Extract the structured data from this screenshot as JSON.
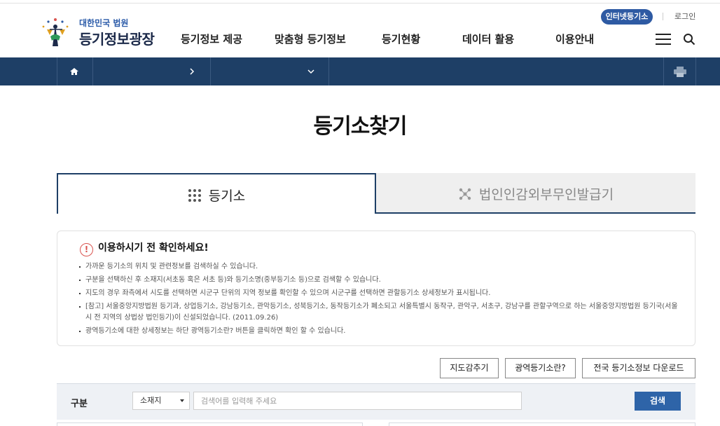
{
  "header": {
    "logo_sub": "대한민국 법원",
    "logo_main": "등기정보광장",
    "util_internet": "인터넷등기소",
    "util_login": "로그인",
    "gnb": [
      "등기정보 제공",
      "맞춤형 등기정보",
      "등기현황",
      "데이터 활용",
      "이용안내"
    ]
  },
  "page": {
    "title": "등기소찾기"
  },
  "tabs": [
    {
      "label": "등기소",
      "icon": "grid-dots-icon",
      "active": true
    },
    {
      "label": "법인인감외부무인발급기",
      "icon": "network-icon",
      "active": false
    }
  ],
  "notice": {
    "title": "이용하시기 전 확인하세요!",
    "items": [
      "가까운 등기소의 위치 및 관련정보를 검색하실 수 있습니다.",
      "구분을 선택하신 후 소재지(서초동 혹은 서초 등)와 등기소명(중부등기소 등)으로 검색할 수 있습니다.",
      "지도의 경우 좌측에서 시도를 선택하면 시군구 단위의 지역 정보를 확인할 수 있으며 시군구를 선택하면 관할등기소 상세정보가 표시됩니다.",
      "[참고] 서울중앙지방법원 등기과, 상업등기소, 강남등기소, 관악등기소, 성북등기소, 동작등기소가 폐소되고 서울특별시 동작구, 관악구, 서초구, 강남구를 관할구역으로 하는 서울중앙지방법원 등기국(서울시 전 지역의 상법상 법인등기)이 신설되었습니다. (2011.09.26)",
      "광역등기소에 대한 상세정보는 하단 광역등기소란? 버튼을 클릭하면 확인 할 수 있습니다."
    ]
  },
  "buttons": {
    "map_hide": "지도감추기",
    "regional": "광역등기소란?",
    "download": "전국 등기소정보 다운로드"
  },
  "search": {
    "label": "구분",
    "select_value": "소재지",
    "placeholder": "검색어를 입력해 주세요",
    "button": "검색"
  },
  "colors": {
    "navy": "#1e3f66",
    "accent_blue": "#2e5aa3",
    "warning_red": "#d9534f"
  }
}
